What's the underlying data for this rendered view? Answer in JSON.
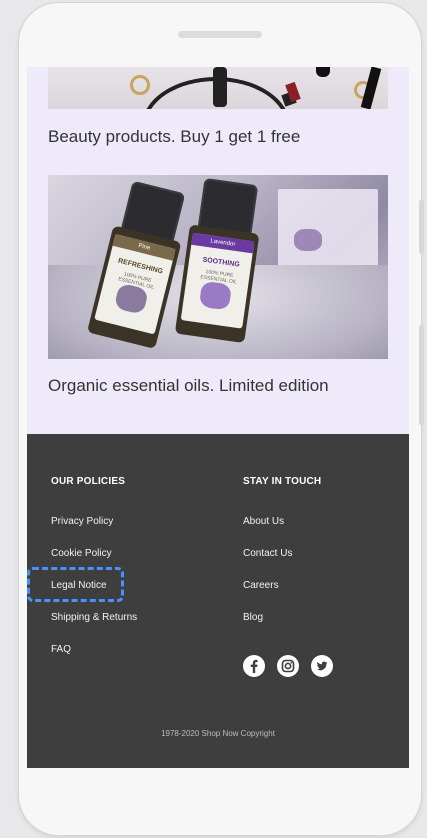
{
  "products": [
    {
      "caption": "Beauty products. Buy 1 get 1 free"
    },
    {
      "caption": "Organic essential oils. Limited edition"
    }
  ],
  "bottles": [
    {
      "band": "Pine",
      "word": "REFRESHING",
      "sub": "100% PURE ESSENTIAL OIL",
      "band_color": "#7a6a4a",
      "art_color": "#8a7aa0"
    },
    {
      "band": "Lavendor",
      "word": "SOOTHING",
      "sub": "100% PURE ESSENTIAL OIL",
      "band_color": "#6a3aa0",
      "art_color": "#9a7ac4"
    }
  ],
  "footer": {
    "policies_title": "OUR POLICIES",
    "policies": [
      "Privacy Policy",
      "Cookie Policy",
      "Legal Notice",
      "Shipping & Returns",
      "FAQ"
    ],
    "touch_title": "STAY IN TOUCH",
    "touch": [
      "About Us",
      "Contact Us",
      "Careers",
      "Blog"
    ],
    "social": [
      "facebook-icon",
      "instagram-icon",
      "twitter-icon"
    ],
    "copyright": "1978-2020 Shop Now Copyright"
  },
  "colors": {
    "page_bg": "#efeafa",
    "footer_bg": "#3e3e3e",
    "focus": "#4a90ff"
  }
}
